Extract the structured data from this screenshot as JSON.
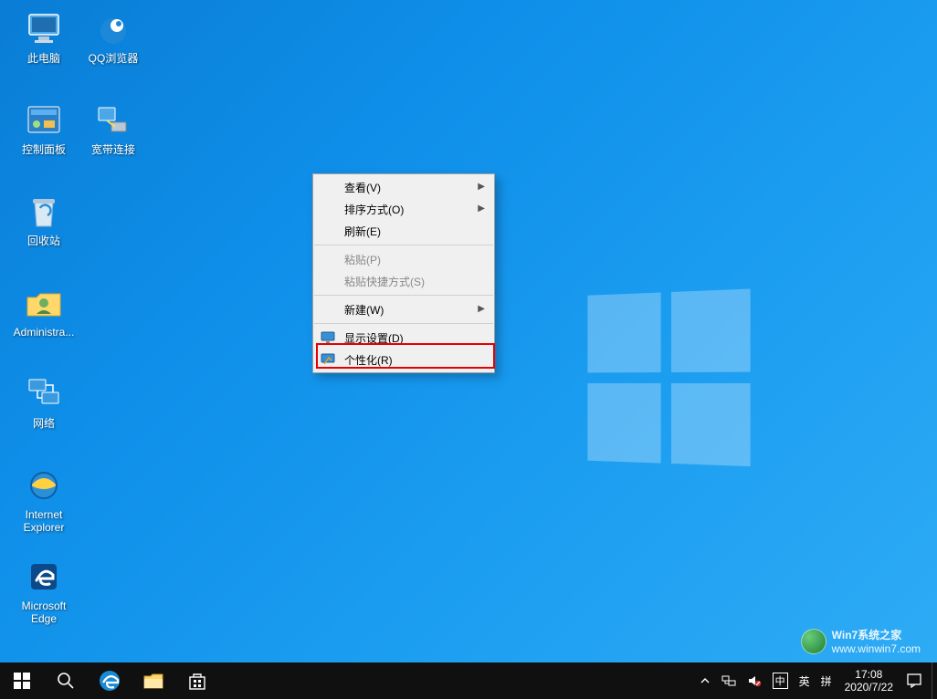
{
  "desktop_icons_col1": [
    {
      "label": "此电脑",
      "type": "computer"
    },
    {
      "label": "控制面板",
      "type": "control-panel"
    },
    {
      "label": "回收站",
      "type": "recycle-bin"
    },
    {
      "label": "Administra...",
      "type": "user-folder"
    },
    {
      "label": "网络",
      "type": "network"
    },
    {
      "label": "Internet Explorer",
      "type": "ie"
    },
    {
      "label": "Microsoft Edge",
      "type": "edge"
    }
  ],
  "desktop_icons_col2": [
    {
      "label": "QQ浏览器",
      "type": "qq-browser"
    },
    {
      "label": "宽带连接",
      "type": "broadband"
    }
  ],
  "context_menu": {
    "view": "查看(V)",
    "sort": "排序方式(O)",
    "refresh": "刷新(E)",
    "paste": "粘贴(P)",
    "paste_shortcut": "粘贴快捷方式(S)",
    "new": "新建(W)",
    "display_settings": "显示设置(D)",
    "personalize": "个性化(R)"
  },
  "taskbar": {
    "start": "开始",
    "search": "搜索",
    "edge": "Edge",
    "explorer": "文件资源管理器",
    "store": "Microsoft Store"
  },
  "tray": {
    "chevron": "显示隐藏的图标",
    "network": "网络",
    "volume": "音量",
    "ime_lang": "中",
    "ime_mode": "英",
    "keyboard": "拼",
    "time": "17:08",
    "date": "2020/7/22",
    "action_center": "操作中心"
  },
  "watermark": {
    "line1": "Win7系统之家",
    "line2": "www.winwin7.com"
  }
}
